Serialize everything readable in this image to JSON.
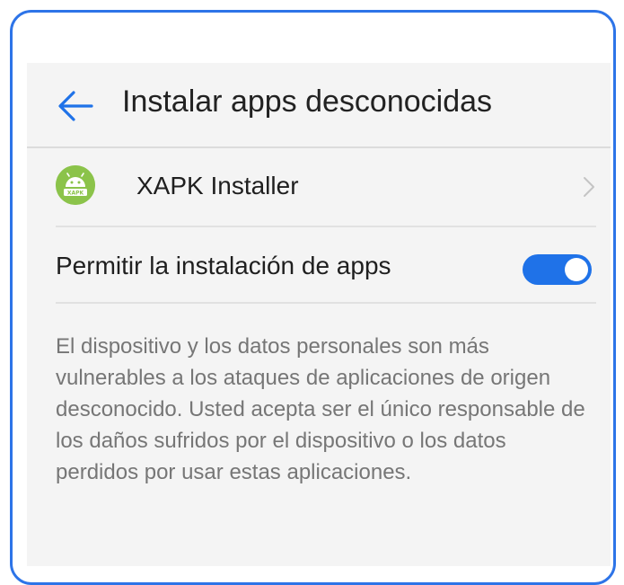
{
  "header": {
    "title": "Instalar apps desconocidas",
    "back_icon": "arrow-left-icon"
  },
  "app_row": {
    "name": "XAPK Installer",
    "icon": "android-icon",
    "icon_badge": "XAPK",
    "chevron_icon": "chevron-right-icon"
  },
  "permission": {
    "label": "Permitir la instalación de apps",
    "enabled": true
  },
  "warning": {
    "text": "El dispositivo y los datos personales son más vulnerables a los ataques de aplicaciones de origen desconocido. Usted acepta ser el único responsable de los daños sufridos por el dispositivo o los datos perdidos por usar estas aplicaciones."
  },
  "colors": {
    "accent": "#1f72e8",
    "frame_border": "#2d74e8",
    "app_icon_bg": "#8bc34a",
    "background": "#f4f4f4"
  }
}
